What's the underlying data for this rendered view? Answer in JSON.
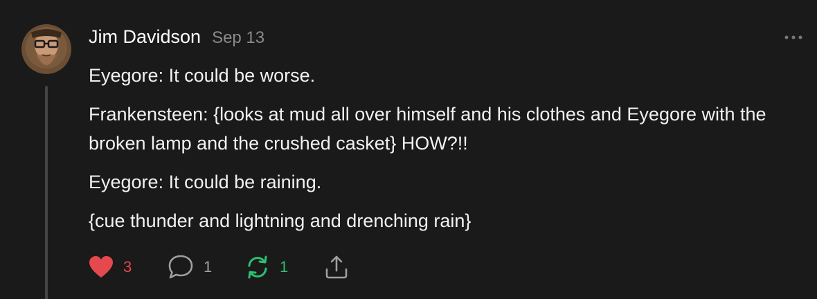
{
  "comment": {
    "author": "Jim Davidson",
    "date": "Sep 13",
    "paragraphs": [
      "Eyegore: It could be worse.",
      "Frankensteen: {looks at mud all over himself and his clothes and Eyegore with the broken lamp and the crushed casket} HOW?!!",
      "Eyegore: It could be raining.",
      "{cue thunder and lightning and drenching rain}"
    ],
    "actions": {
      "likes": "3",
      "replies": "1",
      "restacks": "1"
    }
  },
  "icons": {
    "more": "ellipsis-icon",
    "like": "heart-icon",
    "reply": "speech-bubble-icon",
    "restack": "restack-arrows-icon",
    "share": "share-icon"
  },
  "colors": {
    "background": "#1a1a1a",
    "like": "#e5484d",
    "restack": "#2fbf71",
    "muted": "#8a8a8a"
  }
}
